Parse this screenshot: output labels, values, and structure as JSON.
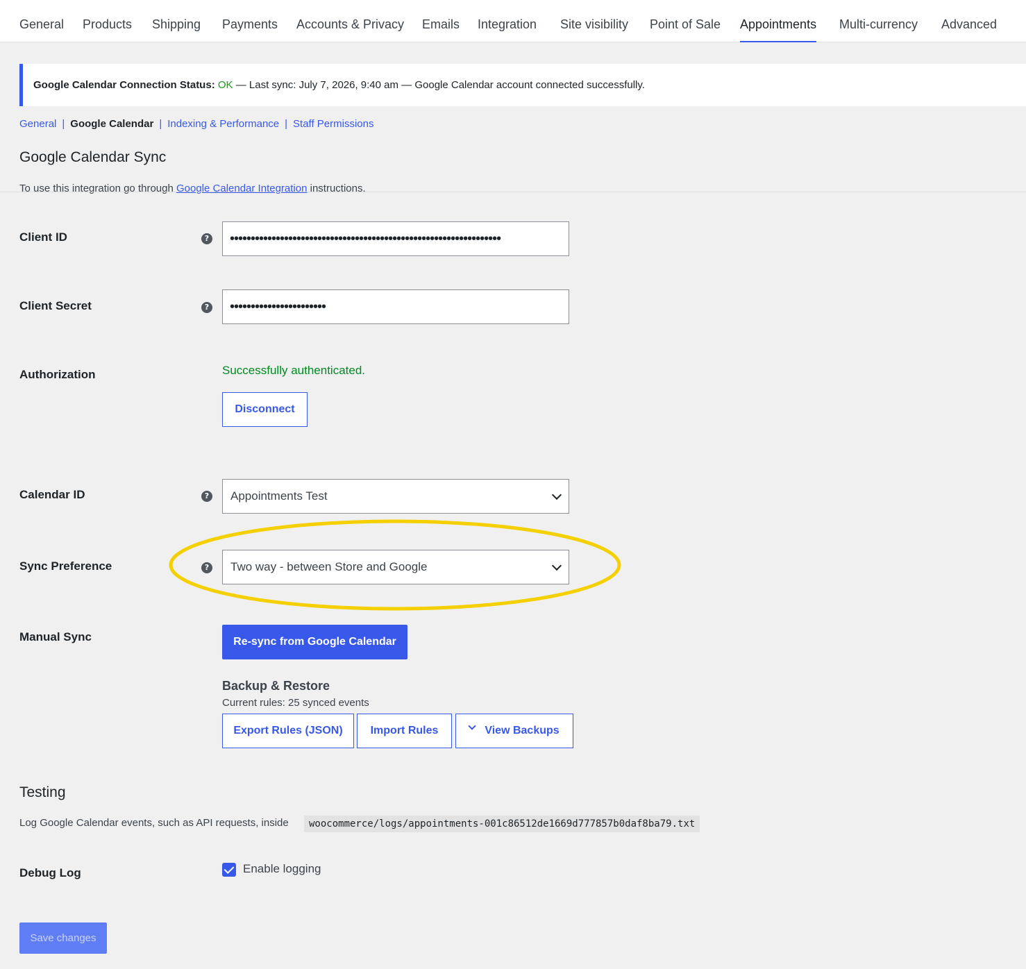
{
  "top_tabs": [
    {
      "label": "General",
      "active": false
    },
    {
      "label": "Products",
      "active": false
    },
    {
      "label": "Shipping",
      "active": false
    },
    {
      "label": "Payments",
      "active": false
    },
    {
      "label": "Accounts & Privacy",
      "active": false
    },
    {
      "label": "Emails",
      "active": false
    },
    {
      "label": "Integration",
      "active": false
    },
    {
      "label": "Site visibility",
      "active": false
    },
    {
      "label": "Point of Sale",
      "active": false
    },
    {
      "label": "Appointments",
      "active": true
    },
    {
      "label": "Multi-currency",
      "active": false
    },
    {
      "label": "Advanced",
      "active": false
    }
  ],
  "notice": {
    "label": "Google Calendar Connection Status:",
    "status": "OK",
    "message": " — Last sync: July 7, 2026, 9:40 am — Google Calendar account connected successfully."
  },
  "subnav": [
    {
      "label": "General",
      "current": false
    },
    {
      "label": "Google Calendar",
      "current": true
    },
    {
      "label": "Indexing & Performance",
      "current": false
    },
    {
      "label": "Staff Permissions",
      "current": false
    }
  ],
  "section": {
    "title": "Google Calendar Sync",
    "desc_prefix": "To use this integration go through ",
    "desc_link": "Google Calendar Integration",
    "desc_suffix": " instructions."
  },
  "fields": {
    "client_id": {
      "label": "Client ID",
      "value": "•••••••••••••••••••••••••••••••••••••••••••••••••••••••••••••••••"
    },
    "client_secret": {
      "label": "Client Secret",
      "value": "•••••••••••••••••••••••"
    },
    "authorization": {
      "label": "Authorization",
      "status": "Successfully authenticated.",
      "button": "Disconnect"
    },
    "calendar_id": {
      "label": "Calendar ID",
      "value": "Appointments Test"
    },
    "sync_preference": {
      "label": "Sync Preference",
      "value": "Two way - between Store and Google"
    },
    "manual_sync": {
      "label": "Manual Sync",
      "button": "Re-sync from Google Calendar"
    }
  },
  "backup": {
    "title": "Backup & Restore",
    "desc": "Current rules: 25 synced events",
    "export_label": "Export Rules (JSON)",
    "import_label": "Import Rules",
    "view_label": "View Backups"
  },
  "testing": {
    "title": "Testing",
    "desc": "Log Google Calendar events, such as API requests, inside",
    "path": "woocommerce/logs/appointments-001c86512de1669d777857b0daf8ba79.txt",
    "debug_label": "Debug Log",
    "checkbox_label": "Enable logging",
    "checked": true
  },
  "save_label": "Save changes",
  "colors": {
    "accent": "#3858e9",
    "success": "#008a20",
    "highlight": "#f5d000"
  },
  "icons": {
    "help": "question-circle-icon",
    "chevron": "chevron-down-icon",
    "check": "checkmark-icon"
  }
}
